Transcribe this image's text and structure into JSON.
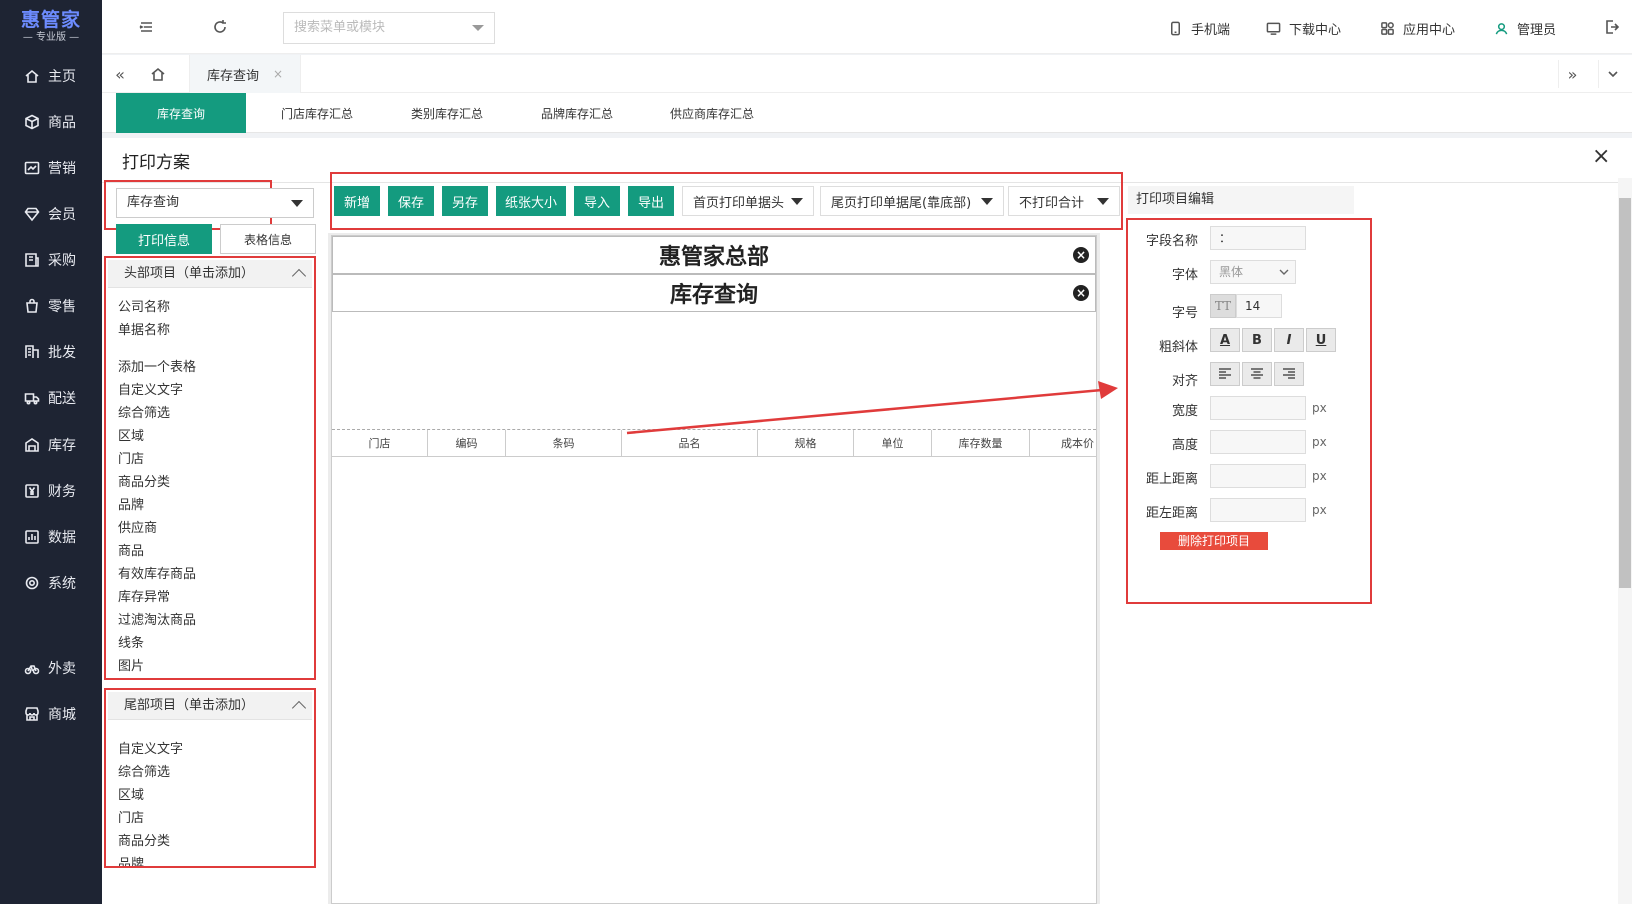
{
  "app": {
    "logo_main": "惠管家",
    "logo_sub": "— 专业版 —"
  },
  "sidebar": {
    "items": [
      {
        "label": "主页",
        "icon": "home-icon"
      },
      {
        "label": "商品",
        "icon": "box-icon"
      },
      {
        "label": "营销",
        "icon": "chart-icon"
      },
      {
        "label": "会员",
        "icon": "diamond-icon"
      },
      {
        "label": "采购",
        "icon": "purchase-icon"
      },
      {
        "label": "零售",
        "icon": "bag-icon"
      },
      {
        "label": "批发",
        "icon": "building-icon"
      },
      {
        "label": "配送",
        "icon": "truck-icon"
      },
      {
        "label": "库存",
        "icon": "warehouse-icon"
      },
      {
        "label": "财务",
        "icon": "yen-icon"
      },
      {
        "label": "数据",
        "icon": "data-icon"
      },
      {
        "label": "系统",
        "icon": "gear-icon"
      },
      {
        "label": "外卖",
        "icon": "bike-icon"
      },
      {
        "label": "商城",
        "icon": "store-icon"
      }
    ]
  },
  "topbar": {
    "search_placeholder": "搜索菜单或模块",
    "links": {
      "mobile": "手机端",
      "download": "下载中心",
      "apps": "应用中心",
      "user": "管理员"
    }
  },
  "tabs": {
    "active_tab": "库存查询",
    "close_glyph": "×"
  },
  "subtabs": [
    "库存查询",
    "门店库存汇总",
    "类别库存汇总",
    "品牌库存汇总",
    "供应商库存汇总"
  ],
  "dialog": {
    "title": "打印方案",
    "close_glyph": "×",
    "scheme_select": "库存查询",
    "toolbar": {
      "new": "新增",
      "save": "保存",
      "save_as": "另存",
      "paper_size": "纸张大小",
      "import": "导入",
      "export": "导出",
      "first_page_header": "首页打印单据头",
      "last_page_footer": "尾页打印单据尾(靠底部)",
      "no_total": "不打印合计"
    },
    "edit_title": "打印项目编辑",
    "panel_tabs": {
      "print_info": "打印信息",
      "table_info": "表格信息"
    },
    "header_panel": {
      "title": "头部项目（单击添加）",
      "items_top": [
        "公司名称",
        "单据名称"
      ],
      "items": [
        "添加一个表格",
        "自定义文字",
        "综合筛选",
        "区域",
        "门店",
        "商品分类",
        "品牌",
        "供应商",
        "商品",
        "有效库存商品",
        "库存异常",
        "过滤淘汰商品",
        "线条",
        "图片"
      ]
    },
    "footer_panel": {
      "title": "尾部项目（单击添加）",
      "items": [
        "自定义文字",
        "综合筛选",
        "区域",
        "门店",
        "商品分类",
        "品牌"
      ]
    },
    "canvas": {
      "company": "惠管家总部",
      "doc_name": "库存查询",
      "columns": [
        "门店",
        "编码",
        "条码",
        "品名",
        "规格",
        "单位",
        "库存数量",
        "成本价"
      ]
    },
    "props": {
      "field_name_label": "字段名称",
      "field_name_value": "：",
      "font_label": "字体",
      "font_value": "黑体",
      "size_label": "字号",
      "size_value": "14",
      "size_icon_text": "TT",
      "style_label": "粗斜体",
      "style_buttons": [
        "A",
        "B",
        "I",
        "U"
      ],
      "align_label": "对齐",
      "width_label": "宽度",
      "height_label": "高度",
      "top_label": "距上距离",
      "left_label": "距左距离",
      "unit": "px",
      "delete_button": "删除打印项目"
    }
  }
}
